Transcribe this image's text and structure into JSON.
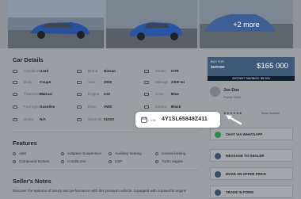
{
  "gallery": {
    "more_label": "+2 more"
  },
  "sections": {
    "details_title": "Car Details",
    "features_title": "Features",
    "notes_title": "Seller's Notes"
  },
  "specs": [
    {
      "label": "Condition",
      "value": "Used"
    },
    {
      "label": "Brand",
      "value": "Nissan"
    },
    {
      "label": "Model",
      "value": "GTR"
    },
    {
      "label": "Body",
      "value": "Coupe"
    },
    {
      "label": "Year",
      "value": "2000"
    },
    {
      "label": "Mileage",
      "value": "2300 mi"
    },
    {
      "label": "Transmission",
      "value": "Manual"
    },
    {
      "label": "Engine",
      "value": "2JZ"
    },
    {
      "label": "Color",
      "value": "Blue"
    },
    {
      "label": "Fuel type",
      "value": "Gasoline"
    },
    {
      "label": "Drive",
      "value": "AWD"
    },
    {
      "label": "Interior",
      "value": "Black"
    },
    {
      "label": "Doors",
      "value": "N/A"
    },
    {
      "label": "Stock ID",
      "value": "01010"
    }
  ],
  "features": [
    "ABS",
    "Adaptive Suspension",
    "Auxiliary heating",
    "Central locking",
    "Compound Brakes",
    "Conditioner",
    "ESP",
    "Turbo engine"
  ],
  "notes_text": "Discover the epitome of luxury and performance with this premium vehicle. Equipped with a powerful engine",
  "price": {
    "label": "BUY FOR",
    "old": "$170 000",
    "current": "$165 000",
    "savings": "INSTANT SAVINGS: $5 000"
  },
  "dealer": {
    "name": "Joe Doe",
    "role": "Private Seller",
    "show_number": "Show Number",
    "stars": "★★★★★★"
  },
  "actions": [
    {
      "label": "CHAT VIA WHATSAPP",
      "color": "#2f8a4a"
    },
    {
      "label": "MESSAGE TO DEALER",
      "color": "#3a4d66"
    },
    {
      "label": "MAKE AN OFFER PRICE",
      "color": "#3a4d66"
    },
    {
      "label": "TRADE IN FORM",
      "color": "#3a4d66"
    }
  ],
  "vin": {
    "label": "VIN",
    "value": "4Y1SL65848Z411"
  },
  "colors": {
    "accent": "#2b64c9",
    "dark": "#1f2833"
  }
}
